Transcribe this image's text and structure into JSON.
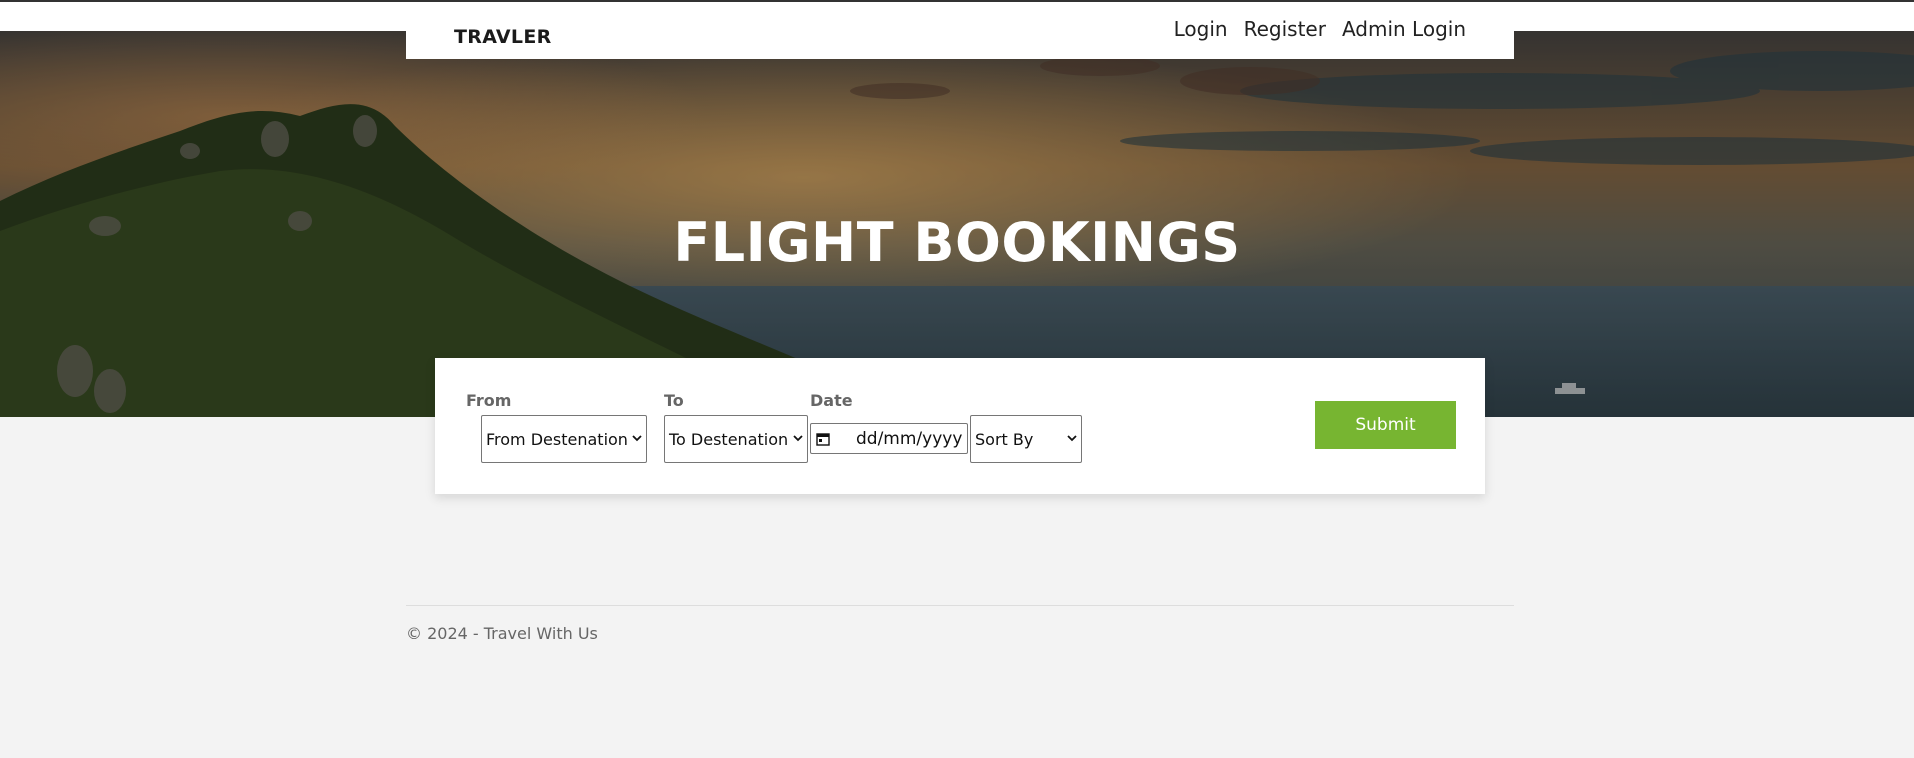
{
  "navbar": {
    "brand": "TRAVLER",
    "links": [
      "Login",
      "Register",
      "Admin Login"
    ]
  },
  "hero": {
    "title": "FLIGHT BOOKINGS"
  },
  "search": {
    "from_label": "From",
    "from_value": "From Destenation",
    "to_label": "To",
    "to_value": "To Destenation",
    "date_label": "Date",
    "date_placeholder": "dd/mm/yyyy",
    "sort_value": "Sort By",
    "submit_label": "Submit"
  },
  "footer": {
    "text": "© 2024 - Travel With Us"
  },
  "colors": {
    "accent": "#77b531",
    "background": "#f3f3f3"
  },
  "icons": {
    "calendar": "calendar-icon",
    "dropdown": "chevron-down-icon"
  }
}
